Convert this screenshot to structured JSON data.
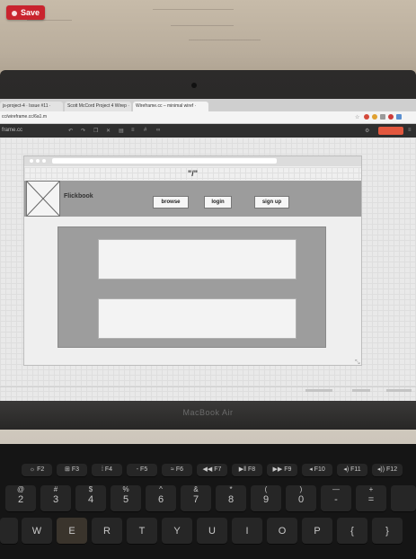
{
  "save_button": {
    "label": "Save"
  },
  "browser": {
    "tabs": [
      {
        "label": "js-project-4 · Issue #11 ·"
      },
      {
        "label": "Scott McCord Project 4 Wirep ·"
      },
      {
        "label": "Wireframe.cc – minimal wiref ·"
      }
    ],
    "url": "cc/wireframe.cc/6a1.m",
    "app_name": "frame.cc"
  },
  "wireframe": {
    "path_label": "\"/\"",
    "brand": "Flickbook",
    "nav": {
      "browse": "browse",
      "login": "login",
      "signup": "sign up"
    }
  },
  "laptop": {
    "brand": "MacBook Air"
  },
  "keyboard": {
    "fn_row": [
      "F2",
      "F3",
      "F4",
      "F5",
      "F6",
      "F7",
      "F8",
      "F9",
      "F10",
      "F11",
      "F12"
    ],
    "number_row": [
      {
        "top": "@",
        "bot": "2"
      },
      {
        "top": "#",
        "bot": "3"
      },
      {
        "top": "$",
        "bot": "4"
      },
      {
        "top": "%",
        "bot": "5"
      },
      {
        "top": "^",
        "bot": "6"
      },
      {
        "top": "&",
        "bot": "7"
      },
      {
        "top": "*",
        "bot": "8"
      },
      {
        "top": "(",
        "bot": "9"
      },
      {
        "top": ")",
        "bot": "0"
      },
      {
        "top": "—",
        "bot": "-"
      },
      {
        "top": "+",
        "bot": "="
      }
    ],
    "letter_row": [
      "W",
      "E",
      "R",
      "T",
      "Y",
      "U",
      "I",
      "O",
      "P",
      "{",
      "}"
    ]
  },
  "colors": {
    "save": "#c9242e",
    "share": "#e2573e",
    "wireframe_nav": "#9c9c9c"
  }
}
